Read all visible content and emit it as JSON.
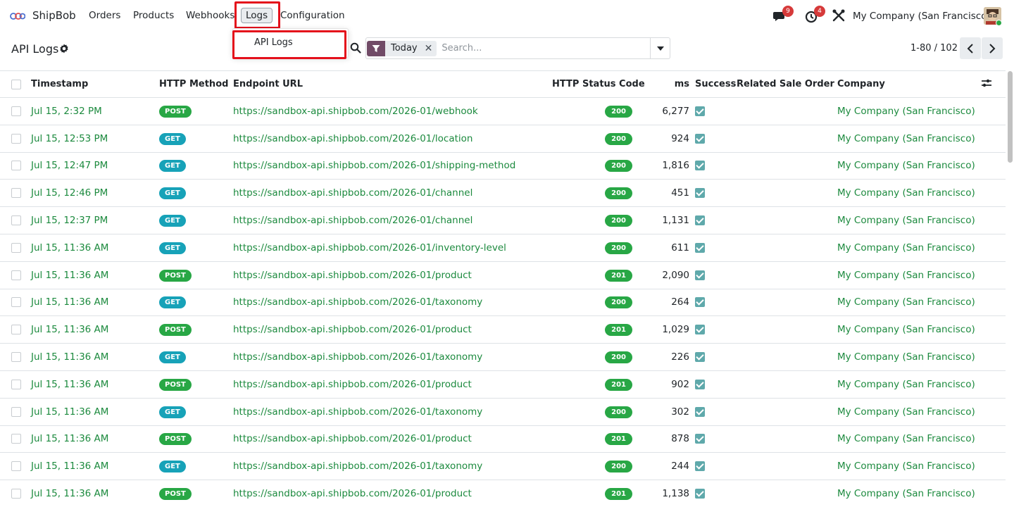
{
  "app": {
    "name": "ShipBob"
  },
  "nav": {
    "menus": [
      "Orders",
      "Products",
      "Webhooks",
      "Logs",
      "Configuration"
    ],
    "chat_count": "9",
    "activity_count": "4",
    "company": "My Company (San Francisco)"
  },
  "dropdown": {
    "items": [
      "API Logs"
    ]
  },
  "control": {
    "title": "API Logs",
    "facet": "Today",
    "search_placeholder": "Search...",
    "pager": "1-80 / 102"
  },
  "columns": {
    "timestamp": "Timestamp",
    "method": "HTTP Method",
    "url": "Endpoint URL",
    "status": "HTTP Status Code",
    "ms": "ms",
    "success": "Success",
    "related": "Related Sale Order",
    "company": "Company"
  },
  "colors": {
    "get": "#17a2b8",
    "post": "#28a745",
    "status_ok": "#28a745",
    "link": "#1c8a3e",
    "highlight": "#e4101b",
    "brand": "#714b67"
  },
  "rows": [
    {
      "timestamp": "Jul 15, 2:32 PM",
      "method": "POST",
      "url": "https://sandbox-api.shipbob.com/2026-01/webhook",
      "status": "200",
      "ms": "6,277",
      "company": "My Company (San Francisco)"
    },
    {
      "timestamp": "Jul 15, 12:53 PM",
      "method": "GET",
      "url": "https://sandbox-api.shipbob.com/2026-01/location",
      "status": "200",
      "ms": "924",
      "company": "My Company (San Francisco)"
    },
    {
      "timestamp": "Jul 15, 12:47 PM",
      "method": "GET",
      "url": "https://sandbox-api.shipbob.com/2026-01/shipping-method",
      "status": "200",
      "ms": "1,816",
      "company": "My Company (San Francisco)"
    },
    {
      "timestamp": "Jul 15, 12:46 PM",
      "method": "GET",
      "url": "https://sandbox-api.shipbob.com/2026-01/channel",
      "status": "200",
      "ms": "451",
      "company": "My Company (San Francisco)"
    },
    {
      "timestamp": "Jul 15, 12:37 PM",
      "method": "GET",
      "url": "https://sandbox-api.shipbob.com/2026-01/channel",
      "status": "200",
      "ms": "1,131",
      "company": "My Company (San Francisco)"
    },
    {
      "timestamp": "Jul 15, 11:36 AM",
      "method": "GET",
      "url": "https://sandbox-api.shipbob.com/2026-01/inventory-level",
      "status": "200",
      "ms": "611",
      "company": "My Company (San Francisco)"
    },
    {
      "timestamp": "Jul 15, 11:36 AM",
      "method": "POST",
      "url": "https://sandbox-api.shipbob.com/2026-01/product",
      "status": "201",
      "ms": "2,090",
      "company": "My Company (San Francisco)"
    },
    {
      "timestamp": "Jul 15, 11:36 AM",
      "method": "GET",
      "url": "https://sandbox-api.shipbob.com/2026-01/taxonomy",
      "status": "200",
      "ms": "264",
      "company": "My Company (San Francisco)"
    },
    {
      "timestamp": "Jul 15, 11:36 AM",
      "method": "POST",
      "url": "https://sandbox-api.shipbob.com/2026-01/product",
      "status": "201",
      "ms": "1,029",
      "company": "My Company (San Francisco)"
    },
    {
      "timestamp": "Jul 15, 11:36 AM",
      "method": "GET",
      "url": "https://sandbox-api.shipbob.com/2026-01/taxonomy",
      "status": "200",
      "ms": "226",
      "company": "My Company (San Francisco)"
    },
    {
      "timestamp": "Jul 15, 11:36 AM",
      "method": "POST",
      "url": "https://sandbox-api.shipbob.com/2026-01/product",
      "status": "201",
      "ms": "902",
      "company": "My Company (San Francisco)"
    },
    {
      "timestamp": "Jul 15, 11:36 AM",
      "method": "GET",
      "url": "https://sandbox-api.shipbob.com/2026-01/taxonomy",
      "status": "200",
      "ms": "302",
      "company": "My Company (San Francisco)"
    },
    {
      "timestamp": "Jul 15, 11:36 AM",
      "method": "POST",
      "url": "https://sandbox-api.shipbob.com/2026-01/product",
      "status": "201",
      "ms": "878",
      "company": "My Company (San Francisco)"
    },
    {
      "timestamp": "Jul 15, 11:36 AM",
      "method": "GET",
      "url": "https://sandbox-api.shipbob.com/2026-01/taxonomy",
      "status": "200",
      "ms": "244",
      "company": "My Company (San Francisco)"
    },
    {
      "timestamp": "Jul 15, 11:36 AM",
      "method": "POST",
      "url": "https://sandbox-api.shipbob.com/2026-01/product",
      "status": "201",
      "ms": "1,138",
      "company": "My Company (San Francisco)"
    }
  ]
}
